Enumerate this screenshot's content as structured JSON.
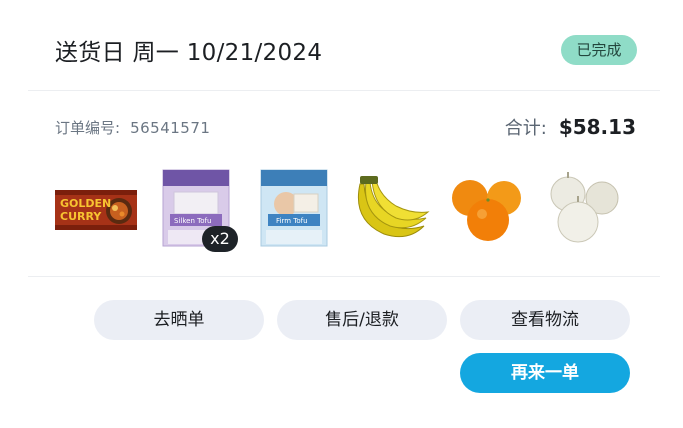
{
  "header": {
    "title": "送货日 周一 10/21/2024",
    "status": "已完成"
  },
  "order": {
    "number_label": "订单编号:",
    "number": "56541571",
    "total_label": "合计:",
    "total_value": "$58.13"
  },
  "products": [
    {
      "name": "golden-curry",
      "label_line1": "GOLDEN",
      "label_line2": "CURRY"
    },
    {
      "name": "silken-tofu",
      "label": "Silken Tofu",
      "quantity": "x2"
    },
    {
      "name": "firm-tofu",
      "label": "Firm Tofu"
    },
    {
      "name": "bananas"
    },
    {
      "name": "oranges"
    },
    {
      "name": "onions"
    }
  ],
  "actions": {
    "review_label": "去晒单",
    "after_sales_label": "售后/退款",
    "logistics_label": "查看物流",
    "reorder_label": "再来一单"
  },
  "colors": {
    "status_badge": "#8fdcc7",
    "primary_button": "#14a7e0",
    "ghost_button": "#ebeef5"
  }
}
